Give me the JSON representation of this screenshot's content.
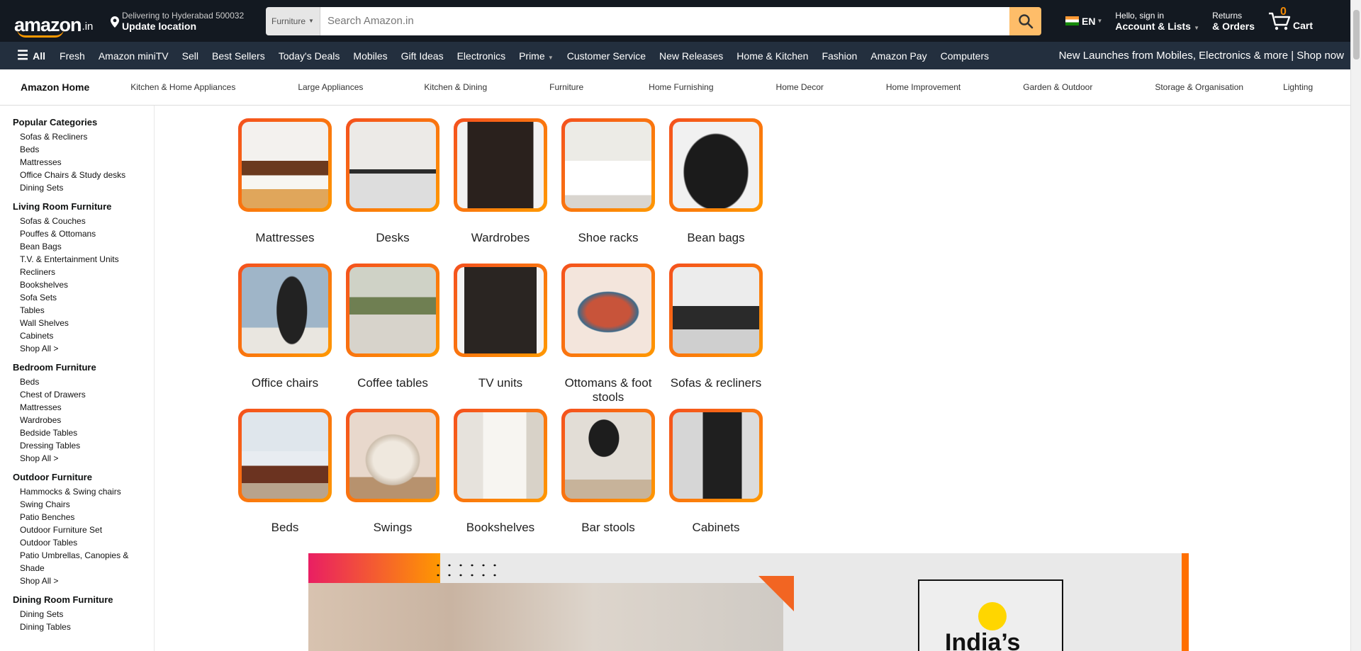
{
  "header": {
    "logo_text": "amazon",
    "logo_tld": ".in",
    "deliver_line1": "Delivering to Hyderabad 500032",
    "deliver_line2": "Update location",
    "search_category": "Furniture",
    "search_placeholder": "Search Amazon.in",
    "language": "EN",
    "account_line1": "Hello, sign in",
    "account_line2": "Account & Lists",
    "returns_line1": "Returns",
    "returns_line2": "& Orders",
    "cart_count": "0",
    "cart_label": "Cart"
  },
  "navbar": {
    "all_label": "All",
    "items": [
      "Fresh",
      "Amazon miniTV",
      "Sell",
      "Best Sellers",
      "Today's Deals",
      "Mobiles",
      "Gift Ideas",
      "Electronics",
      "Prime",
      "Customer Service",
      "New Releases",
      "Home & Kitchen",
      "Fashion",
      "Amazon Pay",
      "Computers"
    ],
    "promo": "New Launches from Mobiles, Electronics & more | Shop now"
  },
  "subnav": {
    "store": "Amazon Home",
    "items": [
      "Kitchen & Home Appliances",
      "Large Appliances",
      "Kitchen & Dining",
      "Furniture",
      "Home Furnishing",
      "Home Decor",
      "Home Improvement",
      "Garden & Outdoor",
      "Storage & Organisation",
      "Lighting"
    ]
  },
  "sidebar": {
    "sections": [
      {
        "title": "Popular Categories",
        "links": [
          "Sofas & Recliners",
          "Beds",
          "Mattresses",
          "Office Chairs & Study desks",
          "Dining Sets"
        ]
      },
      {
        "title": "Living Room Furniture",
        "links": [
          "Sofas & Couches",
          "Pouffes & Ottomans",
          "Bean Bags",
          "T.V. & Entertainment Units",
          "Recliners",
          "Bookshelves",
          "Sofa Sets",
          "Tables",
          "Wall Shelves",
          "Cabinets",
          "Shop All >"
        ]
      },
      {
        "title": "Bedroom Furniture",
        "links": [
          "Beds",
          "Chest of Drawers",
          "Mattresses",
          "Wardrobes",
          "Bedside Tables",
          "Dressing Tables",
          "Shop All >"
        ]
      },
      {
        "title": "Outdoor Furniture",
        "links": [
          "Hammocks & Swing chairs",
          "Swing Chairs",
          "Patio Benches",
          "Outdoor Furniture Set",
          "Outdoor Tables",
          "Patio Umbrellas, Canopies & Shade",
          "Shop All >"
        ]
      },
      {
        "title": "Dining Room Furniture",
        "links": [
          "Dining Sets",
          "Dining Tables"
        ]
      }
    ]
  },
  "categories": [
    {
      "label": "Mattresses"
    },
    {
      "label": "Desks"
    },
    {
      "label": "Wardrobes"
    },
    {
      "label": "Shoe racks"
    },
    {
      "label": "Bean bags"
    },
    {
      "label": "Office chairs"
    },
    {
      "label": "Coffee tables"
    },
    {
      "label": "TV units"
    },
    {
      "label": "Ottomans & foot stools"
    },
    {
      "label": "Sofas & recliners"
    },
    {
      "label": "Beds"
    },
    {
      "label": "Swings"
    },
    {
      "label": "Bookshelves"
    },
    {
      "label": "Bar stools"
    },
    {
      "label": "Cabinets"
    }
  ],
  "banner": {
    "headline": "India’s"
  }
}
